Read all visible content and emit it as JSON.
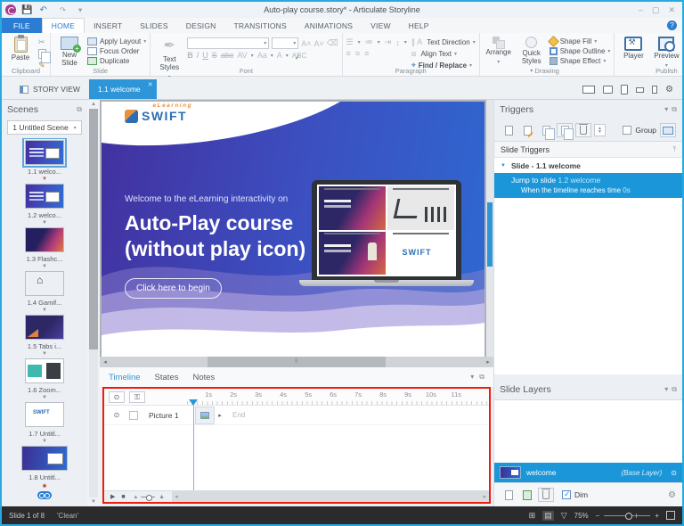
{
  "window": {
    "title": "Auto-play course.story* - Articulate Storyline",
    "minimize": "–",
    "maximize": "▢",
    "close": "✕"
  },
  "menu": {
    "tabs": [
      "FILE",
      "HOME",
      "INSERT",
      "SLIDES",
      "DESIGN",
      "TRANSITIONS",
      "ANIMATIONS",
      "VIEW",
      "HELP"
    ],
    "help_icon": "?"
  },
  "ribbon": {
    "clipboard": {
      "paste": "Paste",
      "label": "Clipboard"
    },
    "slide": {
      "new_slide": "New Slide",
      "apply_layout": "Apply Layout",
      "focus_order": "Focus Order",
      "duplicate": "Duplicate",
      "label": "Slide"
    },
    "font": {
      "text_styles": "Text Styles",
      "bold": "B",
      "italic": "I",
      "underline": "U",
      "strike": "S",
      "abc": "abc",
      "spacing": "AV",
      "case": "Aa",
      "color": "A",
      "proof": "ABC",
      "label": "Font"
    },
    "paragraph": {
      "text_direction": "Text Direction",
      "align_text": "Align Text",
      "find_replace": "Find / Replace",
      "label": "Paragraph"
    },
    "drawing": {
      "arrange": "Arrange",
      "quick_styles": "Quick Styles",
      "shape_fill": "Shape Fill",
      "shape_outline": "Shape Outline",
      "shape_effect": "Shape Effect",
      "label": "Drawing"
    },
    "publish": {
      "player": "Player",
      "preview": "Preview",
      "publish": "Publish",
      "label": "Publish"
    }
  },
  "tabbar": {
    "story_view": "STORY VIEW",
    "active_tab": "1.1 welcome",
    "close": "✕"
  },
  "scenes": {
    "title": "Scenes",
    "selector": "1 Untitled Scene",
    "items": [
      {
        "label": "1.1 welco..."
      },
      {
        "label": "1.2 welco..."
      },
      {
        "label": "1.3 Flashc..."
      },
      {
        "label": "1.4 Gamif..."
      },
      {
        "label": "1.5 Tabs i..."
      },
      {
        "label": "1.6 Zoom..."
      },
      {
        "label": "1.7 Untitl..."
      },
      {
        "label": "1.8 Untitl..."
      }
    ]
  },
  "slide": {
    "logo_text": "SWIFT",
    "logo_super": "eLearning",
    "intro": "Welcome to the eLearning interactivity on",
    "title_line1": "Auto-Play course",
    "title_line2": "(without play icon)",
    "button": "Click here to begin"
  },
  "timeline": {
    "tab_timeline": "Timeline",
    "tab_states": "States",
    "tab_notes": "Notes",
    "ruler": [
      "1s",
      "2s",
      "3s",
      "4s",
      "5s",
      "6s",
      "7s",
      "8s",
      "9s",
      "10s",
      "11s"
    ],
    "track_name": "Picture 1",
    "end_label": "End"
  },
  "triggers": {
    "title": "Triggers",
    "group_label": "Group",
    "section": "Slide Triggers",
    "slide_header": "Slide - 1.1 welcome",
    "action": "Jump to slide",
    "target": "1.2 welcome",
    "condition": "When the timeline reaches time",
    "time": "0s"
  },
  "layers": {
    "title": "Slide Layers",
    "name": "welcome",
    "type": "(Base Layer)",
    "dim": "Dim"
  },
  "statusbar": {
    "slide_info": "Slide 1 of 8",
    "state": "'Clean'",
    "zoom": "75%"
  },
  "colors": {
    "accent": "#2e96d8",
    "selection": "#1b97d9",
    "timeline_outline": "#ee1c0c",
    "file_tab": "#2b7cd3"
  }
}
